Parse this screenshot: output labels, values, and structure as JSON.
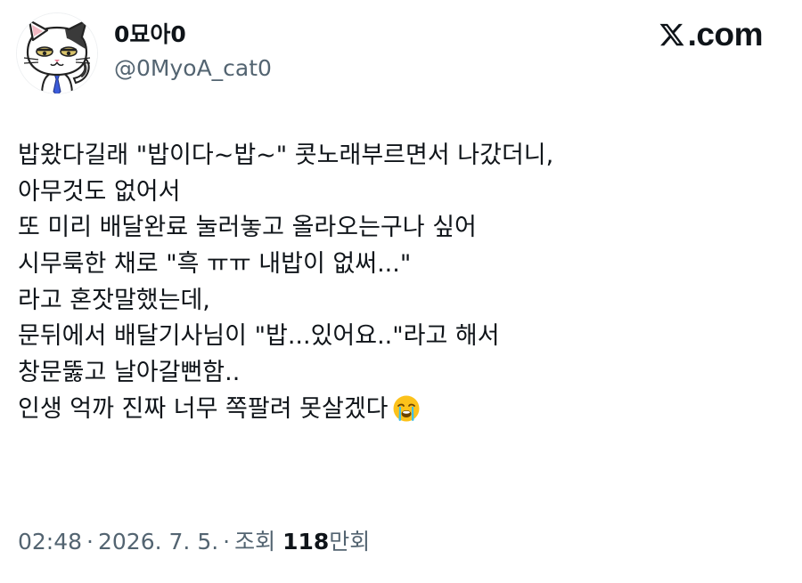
{
  "author": {
    "display_name": "0묘아0",
    "handle": "@0MyoA_cat0",
    "avatar_icon": "cat-avatar-icon"
  },
  "brand": {
    "logo_icon": "x-logo-icon",
    "text": ".com"
  },
  "tweet": {
    "lines": [
      "밥왔다길래 \"밥이다~밥~\" 콧노래부르면서 나갔더니,",
      "아무것도 없어서",
      "또 미리 배달완료 눌러놓고 올라오는구나 싶어",
      "시무룩한 채로 \"흑 ㅠㅠ 내밥이 없써...\"",
      "라고 혼잣말했는데,",
      "문뒤에서 배달기사님이 \"밥...있어요..\"라고 해서",
      "창문뚫고 날아갈뻔함..",
      "인생 억까 진짜 너무 쪽팔려 못살겠다"
    ],
    "trailing_emoji": "loudly-crying-face-emoji"
  },
  "meta": {
    "time": "02:48",
    "date": "2026. 7. 5.",
    "separator": "·",
    "views_label": "조회",
    "views_number": "118",
    "views_unit": "만회"
  },
  "colors": {
    "text_primary": "#0f1419",
    "text_secondary": "#536471",
    "background": "#ffffff",
    "emoji_face": "#fcc21b",
    "emoji_tears": "#40c0e7"
  }
}
